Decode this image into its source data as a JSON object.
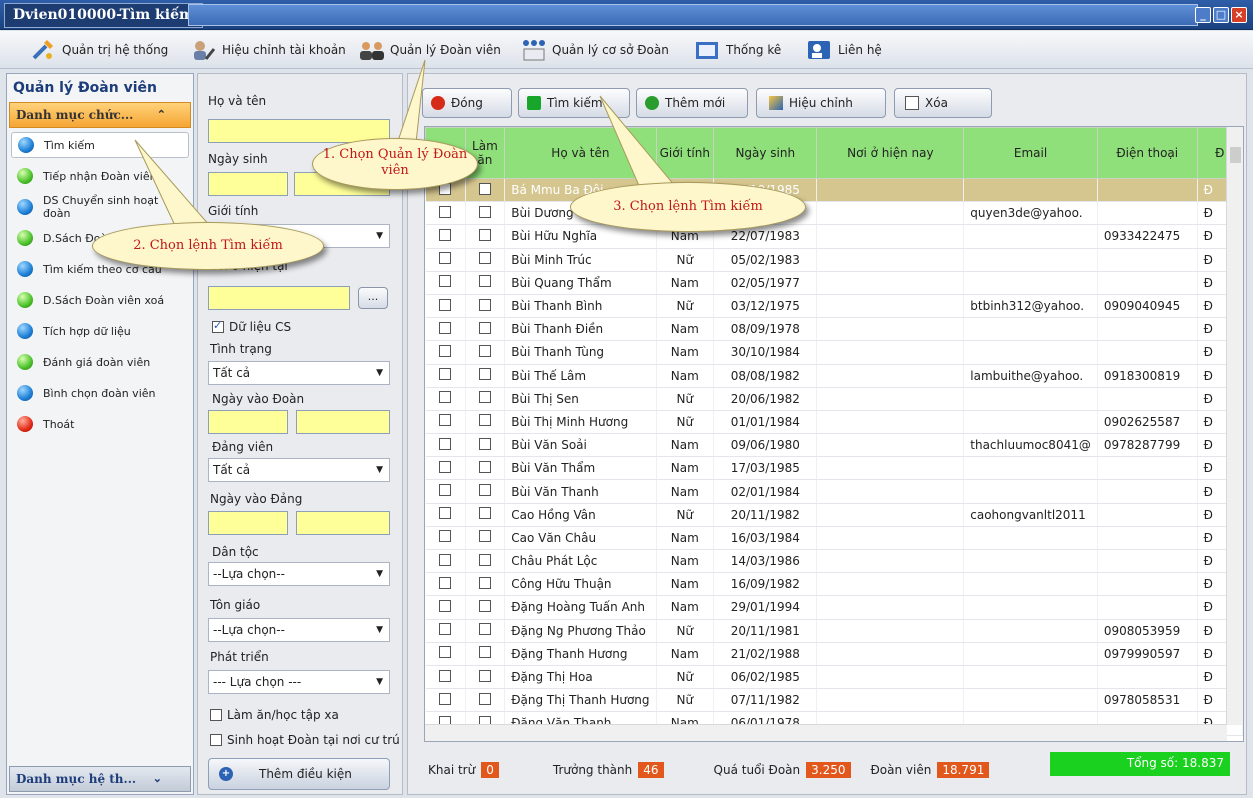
{
  "window": {
    "title": "Dvien010000-Tìm kiếm"
  },
  "menu": [
    {
      "label": "Quản trị hệ thống",
      "icon": "tools-icon"
    },
    {
      "label": "Hiệu chỉnh tài khoản",
      "icon": "user-edit-icon"
    },
    {
      "label": "Quản lý Đoàn viên",
      "icon": "members-icon"
    },
    {
      "label": "Quản lý cơ sở Đoàn",
      "icon": "organization-icon"
    },
    {
      "label": "Thống kê",
      "icon": "statistics-icon"
    },
    {
      "label": "Liên hệ",
      "icon": "contact-icon"
    }
  ],
  "sidebar": {
    "title": "Quản lý Đoàn viên",
    "category": "Danh mục chức...",
    "bottom_category": "Danh mục hệ th...",
    "items": [
      {
        "label": "Tìm kiếm",
        "color": "#1d7fd6"
      },
      {
        "label": "Tiếp nhận Đoàn viên",
        "color": "#4bc12a"
      },
      {
        "label": "DS Chuyển sinh hoạt đoàn",
        "color": "#1d7fd6"
      },
      {
        "label": "D.Sách Đoàn viên",
        "color": "#4bc12a"
      },
      {
        "label": "Tìm kiếm theo cơ cấu",
        "color": "#1d7fd6"
      },
      {
        "label": "D.Sách Đoàn viên xoá",
        "color": "#4bc12a"
      },
      {
        "label": "Tích hợp dữ liệu",
        "color": "#1d7fd6"
      },
      {
        "label": "Đánh giá đoàn viên",
        "color": "#4bc12a"
      },
      {
        "label": "Bình chọn đoàn viên",
        "color": "#1d7fd6"
      },
      {
        "label": "Thoát",
        "color": "#e32a17"
      }
    ]
  },
  "filter": {
    "ho_ten": "Họ và tên",
    "ngay_sinh": "Ngày sinh",
    "gioi_tinh": "Giới tính",
    "noi_o": "Nơi ở hiện tại",
    "du_lieu_cs": "Dữ liệu CS",
    "tinh_trang": "Tình trạng",
    "tinh_trang_value": "Tất cả",
    "ngay_vao_doan": "Ngày vào Đoàn",
    "dang_vien": "Đảng viên",
    "dang_vien_value": "Tất cả",
    "ngay_vao_dang": "Ngày vào Đảng",
    "dan_toc": "Dân tộc",
    "dan_toc_value": "--Lựa chọn--",
    "ton_giao": "Tôn giáo",
    "ton_giao_value": "--Lựa chọn--",
    "phat_trien": "Phát triển",
    "phat_trien_value": "--- Lựa chọn ---",
    "lam_an_xa": "Làm ăn/học tập xa",
    "sinh_hoat": "Sinh hoạt Đoàn tại nơi cư trú",
    "add_condition": "Thêm điều kiện",
    "browse": "..."
  },
  "toolbar": {
    "close": "Đóng",
    "search": "Tìm kiếm",
    "add": "Thêm mới",
    "edit": "Hiệu chỉnh",
    "delete": "Xóa"
  },
  "table": {
    "headers": [
      "Làm ăn",
      "Họ và tên",
      "Giới tính",
      "Ngày sinh",
      "Nơi ở hiện nay",
      "Email",
      "Điện thoại",
      "Đ"
    ],
    "rows": [
      [
        "Bá Mmu Ba Đôi",
        "",
        "07/10/1985",
        "",
        "",
        "",
        "Đ"
      ],
      [
        "Bùi Dương",
        "",
        "1981",
        "",
        "quyen3de@yahoo.",
        "",
        "Đ"
      ],
      [
        "Bùi Hữu Nghĩa",
        "Nam",
        "22/07/1983",
        "",
        "",
        "0933422475",
        "Đ"
      ],
      [
        "Bùi Minh Trúc",
        "Nữ",
        "05/02/1983",
        "",
        "",
        "",
        "Đ"
      ],
      [
        "Bùi Quang Thẩm",
        "Nam",
        "02/05/1977",
        "",
        "",
        "",
        "Đ"
      ],
      [
        "Bùi Thanh Bình",
        "Nữ",
        "03/12/1975",
        "",
        "btbinh312@yahoo.",
        "0909040945",
        "Đ"
      ],
      [
        "Bùi Thanh Điền",
        "Nam",
        "08/09/1978",
        "",
        "",
        "",
        "Đ"
      ],
      [
        "Bùi Thanh Tùng",
        "Nam",
        "30/10/1984",
        "",
        "",
        "",
        "Đ"
      ],
      [
        "Bùi Thế Lâm",
        "Nam",
        "08/08/1982",
        "",
        "lambuithe@yahoo.",
        "0918300819",
        "Đ"
      ],
      [
        "Bùi Thị Sen",
        "Nữ",
        "20/06/1982",
        "",
        "",
        "",
        "Đ"
      ],
      [
        "Bùi Thị Minh Hương",
        "Nữ",
        "01/01/1984",
        "",
        "",
        "0902625587",
        "Đ"
      ],
      [
        "Bùi Văn Soải",
        "Nam",
        "09/06/1980",
        "",
        "thachluumoc8041@",
        "0978287799",
        "Đ"
      ],
      [
        "Bùi Văn Thẩm",
        "Nam",
        "17/03/1985",
        "",
        "",
        "",
        "Đ"
      ],
      [
        "Bùi Văn Thanh",
        "Nam",
        "02/01/1984",
        "",
        "",
        "",
        "Đ"
      ],
      [
        "Cao Hồng Vân",
        "Nữ",
        "20/11/1982",
        "",
        "caohongvanltl2011",
        "",
        "Đ"
      ],
      [
        "Cao Văn Châu",
        "Nam",
        "16/03/1984",
        "",
        "",
        "",
        "Đ"
      ],
      [
        "Châu Phát Lộc",
        "Nam",
        "14/03/1986",
        "",
        "",
        "",
        "Đ"
      ],
      [
        "Công Hữu Thuận",
        "Nam",
        "16/09/1982",
        "",
        "",
        "",
        "Đ"
      ],
      [
        "Đặng Hoàng Tuấn Anh",
        "Nam",
        "29/01/1994",
        "",
        "",
        "",
        "Đ"
      ],
      [
        "Đặng Ng Phương Thảo",
        "Nữ",
        "20/11/1981",
        "",
        "",
        "0908053959",
        "Đ"
      ],
      [
        "Đặng Thanh Hương",
        "Nam",
        "21/02/1988",
        "",
        "",
        "0979990597",
        "Đ"
      ],
      [
        "Đặng Thị Hoa",
        "Nữ",
        "06/02/1985",
        "",
        "",
        "",
        "Đ"
      ],
      [
        "Đặng Thị Thanh Hương",
        "Nữ",
        "07/11/1982",
        "",
        "",
        "0978058531",
        "Đ"
      ],
      [
        "Đặng Văn Thanh",
        "Nam",
        "06/01/1978",
        "",
        "",
        "",
        "Đ"
      ]
    ]
  },
  "footer": {
    "khai_tru_label": "Khai trừ",
    "khai_tru": "0",
    "truong_thanh_label": "Trưởng thành",
    "truong_thanh": "46",
    "qua_tuoi_label": "Quá tuổi Đoàn",
    "qua_tuoi": "3.250",
    "doan_vien_label": "Đoàn viên",
    "doan_vien": "18.791",
    "total": "Tổng số: 18.837"
  },
  "callouts": {
    "c1": "1. Chọn Quản lý Đoàn viên",
    "c2": "2. Chọn lệnh Tìm kiếm",
    "c3": "3. Chọn lệnh Tìm kiếm"
  }
}
